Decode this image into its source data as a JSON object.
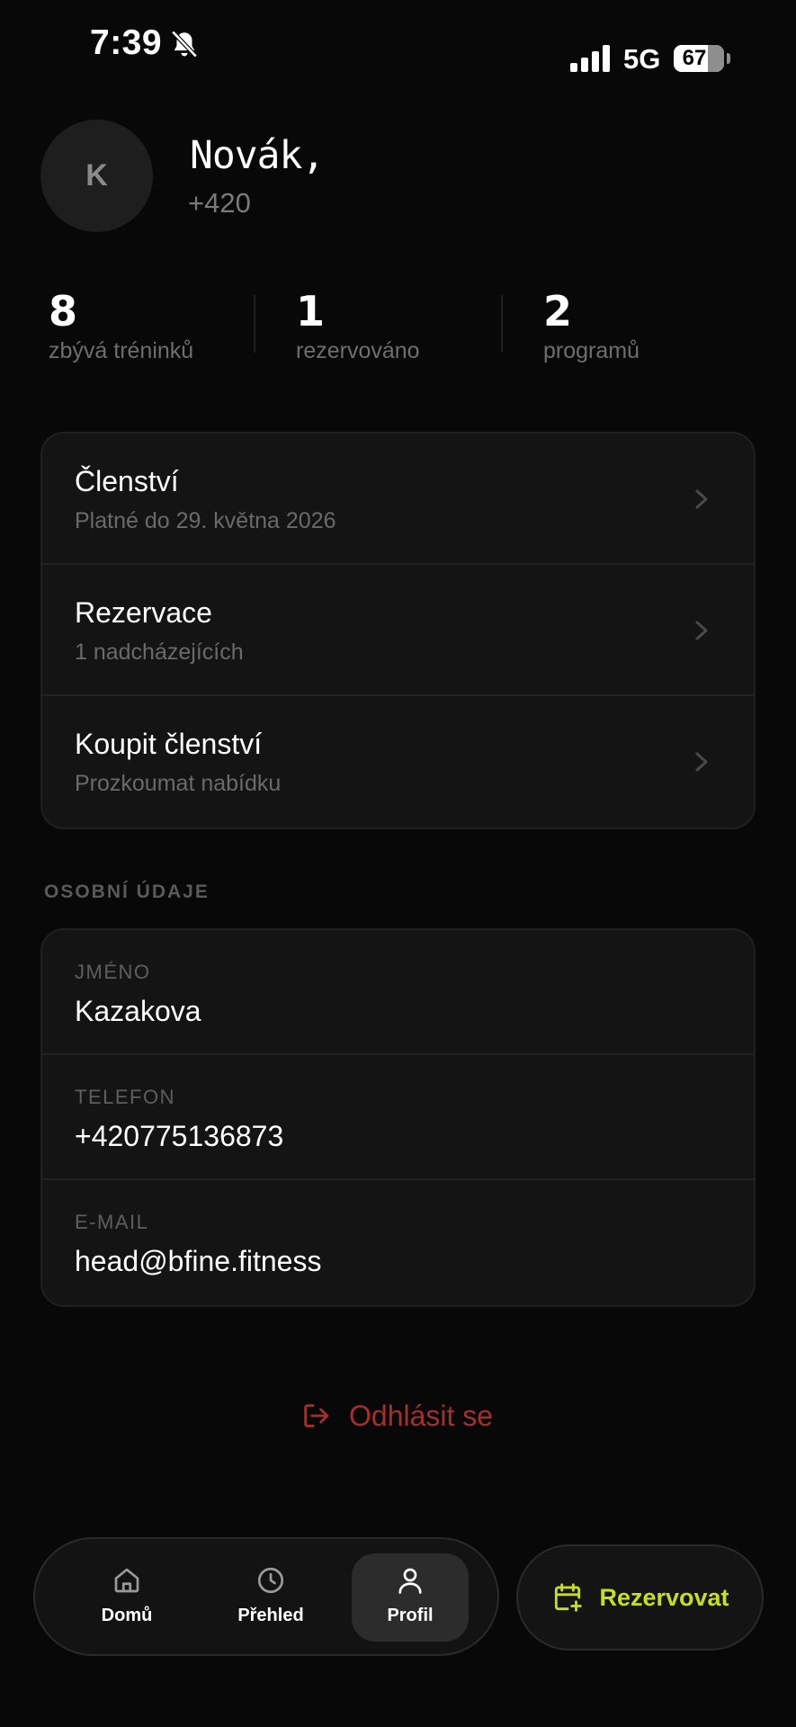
{
  "status_bar": {
    "time": "7:39",
    "network": "5G",
    "battery_percent": "67",
    "battery_level": 0.67,
    "icons": [
      "bell-slash-icon",
      "signal-bars-icon",
      "battery-icon"
    ]
  },
  "profile": {
    "avatar_initial": "K",
    "name": "Novák,",
    "phone": "+420"
  },
  "stats": [
    {
      "value": "8",
      "label": "zbývá tréninků"
    },
    {
      "value": "1",
      "label": "rezervováno"
    },
    {
      "value": "2",
      "label": "programů"
    }
  ],
  "menu": [
    {
      "title": "Členství",
      "subtitle": "Platné do 29. května 2026",
      "icon": "chevron-right-icon"
    },
    {
      "title": "Rezervace",
      "subtitle": "1 nadcházejících",
      "icon": "chevron-right-icon"
    },
    {
      "title": "Koupit členství",
      "subtitle": "Prozkoumat nabídku",
      "icon": "chevron-right-icon"
    }
  ],
  "personal": {
    "heading": "OSOBNÍ ÚDAJE",
    "fields": [
      {
        "label": "JMÉNO",
        "value": "Kazakova"
      },
      {
        "label": "TELEFON",
        "value": "+420775136873"
      },
      {
        "label": "E-MAIL",
        "value": "head@bfine.fitness"
      }
    ]
  },
  "logout": {
    "label": "Odhlásit se",
    "icon": "logout-icon"
  },
  "nav": {
    "items": [
      {
        "label": "Domů",
        "icon": "home-icon",
        "active": false
      },
      {
        "label": "Přehled",
        "icon": "clock-icon",
        "active": false
      },
      {
        "label": "Profil",
        "icon": "user-icon",
        "active": true
      }
    ],
    "reserve_label": "Rezervovat",
    "reserve_icon": "calendar-plus-icon"
  },
  "colors": {
    "background": "#080808",
    "card": "#141414",
    "accent": "#c6e01e",
    "danger": "#a3302c"
  }
}
